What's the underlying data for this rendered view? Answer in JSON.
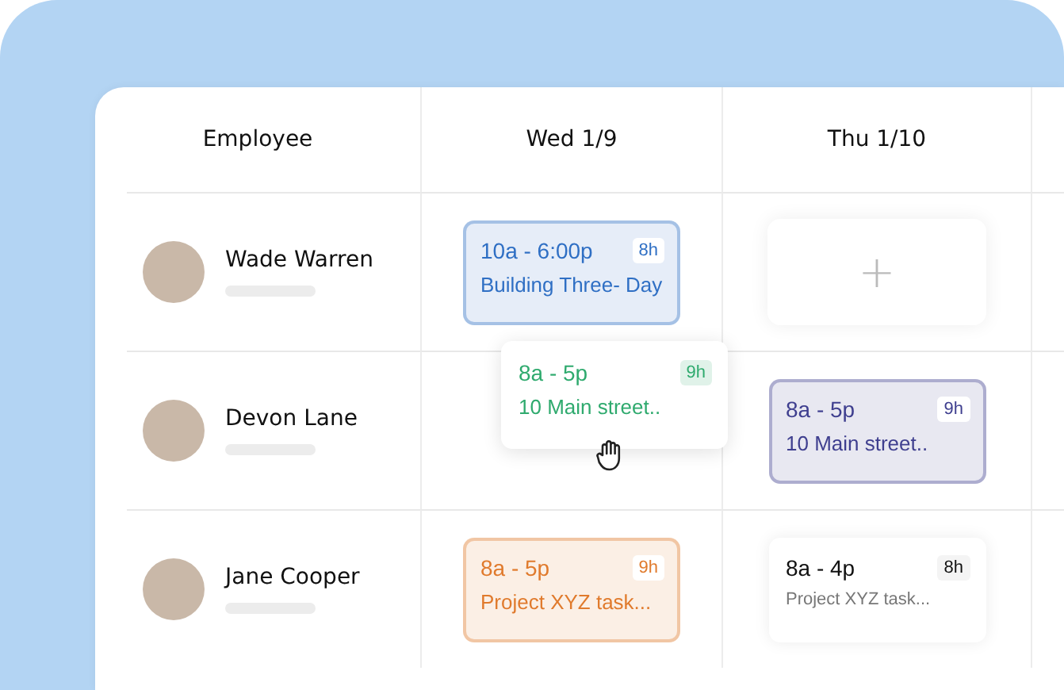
{
  "table": {
    "columns": [
      "Employee",
      "Wed 1/9",
      "Thu 1/10"
    ],
    "rows": [
      {
        "employee": "Wade Warren",
        "shifts": [
          {
            "kind": "shift",
            "time": "10a - 6:00p",
            "hours": "8h",
            "location": "Building Three- Day",
            "color": "#2f6fc4"
          },
          {
            "kind": "empty",
            "icon": "+"
          }
        ]
      },
      {
        "employee": "Devon Lane",
        "shifts": [
          {
            "kind": "none"
          },
          {
            "kind": "shift",
            "time": "8a - 5p",
            "hours": "9h",
            "location": "10 Main street..",
            "color": "#3f3f8f"
          }
        ]
      },
      {
        "employee": "Jane Cooper",
        "shifts": [
          {
            "kind": "shift",
            "time": "8a - 5p",
            "hours": "9h",
            "location": "Project XYZ task...",
            "color": "#e07a2c"
          },
          {
            "kind": "plain",
            "time": "8a - 4p",
            "hours": "8h",
            "location": "Project XYZ task..."
          }
        ]
      }
    ]
  },
  "dragged_shift": {
    "time": "8a - 5p",
    "hours": "9h",
    "location": "10 Main street..",
    "color": "#2faa6e"
  }
}
